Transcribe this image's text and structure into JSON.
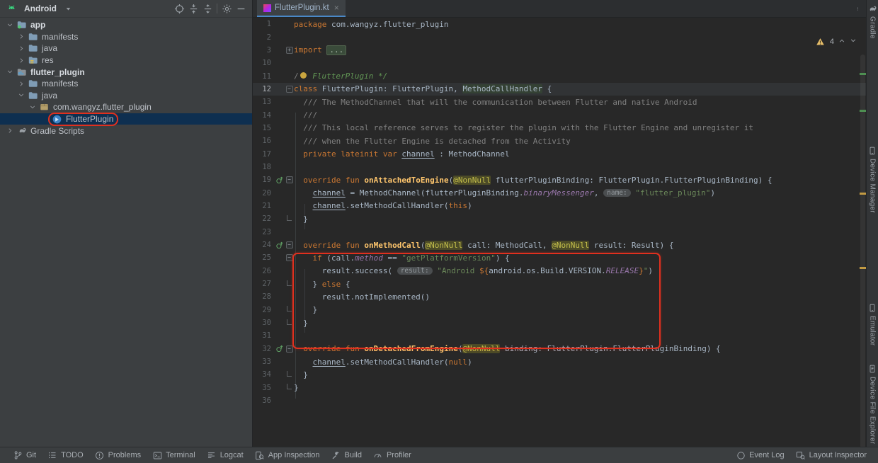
{
  "colors": {
    "annotation_red": "#e0301e",
    "accent_blue": "#4a88c7",
    "selection_bg": "#0e2f50",
    "warning_yellow": "#e8bf6a",
    "editor_bg": "#282828",
    "panel_bg": "#3c3f41"
  },
  "project_panel": {
    "header": {
      "title": "Android",
      "toolbar": [
        {
          "name": "locate"
        },
        {
          "name": "expand-all"
        },
        {
          "name": "collapse-all"
        },
        {
          "name": "sep"
        },
        {
          "name": "settings"
        },
        {
          "name": "hide-panel"
        }
      ]
    },
    "tree": [
      {
        "label": "app",
        "depth": 0,
        "arrow": "expanded",
        "icon": "folder-app",
        "bold": true
      },
      {
        "label": "manifests",
        "depth": 1,
        "arrow": "collapsed",
        "icon": "folder"
      },
      {
        "label": "java",
        "depth": 1,
        "arrow": "collapsed",
        "icon": "folder"
      },
      {
        "label": "res",
        "depth": 1,
        "arrow": "collapsed",
        "icon": "folder-res"
      },
      {
        "label": "flutter_plugin",
        "depth": 0,
        "arrow": "expanded",
        "icon": "module",
        "bold": true
      },
      {
        "label": "manifests",
        "depth": 1,
        "arrow": "collapsed",
        "icon": "folder"
      },
      {
        "label": "java",
        "depth": 1,
        "arrow": "expanded",
        "icon": "folder"
      },
      {
        "label": "com.wangyz.flutter_plugin",
        "depth": 2,
        "arrow": "expanded",
        "icon": "package"
      },
      {
        "label": "FlutterPlugin",
        "depth": 3,
        "arrow": "none",
        "icon": "kotlin-class",
        "selected": true,
        "annotated": true
      },
      {
        "label": "Gradle Scripts",
        "depth": 0,
        "arrow": "collapsed",
        "icon": "gradle"
      }
    ]
  },
  "editor": {
    "tab": {
      "title": "FlutterPlugin.kt",
      "close_label": "×"
    },
    "inspection_widget": {
      "warning_count": "4"
    },
    "lines": [
      {
        "n": "1",
        "g": [],
        "tok": [
          [
            "kw",
            "package"
          ],
          [
            "t",
            " com.wangyz.flutter_plugin"
          ]
        ]
      },
      {
        "n": "2",
        "g": [],
        "tok": []
      },
      {
        "n": "3",
        "g": [
          "plus"
        ],
        "tok": [
          [
            "kw",
            "import"
          ],
          [
            "t",
            " "
          ],
          [
            "fold",
            "..."
          ]
        ]
      },
      {
        "n": "10",
        "g": [],
        "tok": []
      },
      {
        "n": "11",
        "g": [],
        "tok": [
          [
            "cmt",
            "/"
          ],
          [
            "bulb",
            "*"
          ],
          [
            "cmtI",
            " FlutterPlugin */"
          ]
        ]
      },
      {
        "n": "12",
        "g": [
          "minus"
        ],
        "caret": true,
        "tok": [
          [
            "kw",
            "class"
          ],
          [
            "t",
            " FlutterPlugin: FlutterPlugin, "
          ],
          [
            "hl",
            "MethodCallHandler"
          ],
          [
            "t",
            " {"
          ]
        ]
      },
      {
        "n": "13",
        "g": [],
        "tok": [
          [
            "doc",
            "  /// The MethodChannel that will the communication between Flutter and native Android"
          ]
        ]
      },
      {
        "n": "14",
        "g": [],
        "tok": [
          [
            "doc",
            "  ///"
          ]
        ]
      },
      {
        "n": "15",
        "g": [],
        "tok": [
          [
            "doc",
            "  /// This local reference serves to register the plugin with the Flutter Engine and unregister it"
          ]
        ]
      },
      {
        "n": "16",
        "g": [],
        "tok": [
          [
            "doc",
            "  /// when the Flutter Engine is detached from the Activity"
          ]
        ]
      },
      {
        "n": "17",
        "g": [],
        "tok": [
          [
            "t",
            "  "
          ],
          [
            "kw",
            "private lateinit var"
          ],
          [
            "t",
            " "
          ],
          [
            "field",
            "channel"
          ],
          [
            "t",
            " : MethodChannel"
          ]
        ]
      },
      {
        "n": "18",
        "g": [],
        "tok": []
      },
      {
        "n": "19",
        "g": [
          "override",
          "minus"
        ],
        "tok": [
          [
            "t",
            "  "
          ],
          [
            "kw",
            "override fun"
          ],
          [
            "t",
            " "
          ],
          [
            "fn",
            "onAttachedToEngine"
          ],
          [
            "t",
            "("
          ],
          [
            "ann",
            "@NonNull"
          ],
          [
            "t",
            " flutterPluginBinding: FlutterPlugin.FlutterPluginBinding) {"
          ]
        ]
      },
      {
        "n": "20",
        "g": [],
        "tok": [
          [
            "t",
            "    "
          ],
          [
            "field",
            "channel"
          ],
          [
            "t",
            " = MethodChannel(flutterPluginBinding."
          ],
          [
            "prop",
            "binaryMessenger"
          ],
          [
            "t",
            ", "
          ],
          [
            "hint",
            "name:"
          ],
          [
            "t",
            " "
          ],
          [
            "str",
            "\"flutter_plugin\""
          ],
          [
            "t",
            ")"
          ]
        ]
      },
      {
        "n": "21",
        "g": [],
        "tok": [
          [
            "t",
            "    "
          ],
          [
            "field",
            "channel"
          ],
          [
            "t",
            ".setMethodCallHandler("
          ],
          [
            "kw",
            "this"
          ],
          [
            "t",
            ")"
          ]
        ]
      },
      {
        "n": "22",
        "g": [
          "end"
        ],
        "tok": [
          [
            "t",
            "  }"
          ]
        ]
      },
      {
        "n": "23",
        "g": [],
        "tok": []
      },
      {
        "n": "24",
        "g": [
          "override",
          "minus"
        ],
        "tok": [
          [
            "t",
            "  "
          ],
          [
            "kw",
            "override fun"
          ],
          [
            "t",
            " "
          ],
          [
            "fn",
            "onMethodCall"
          ],
          [
            "t",
            "("
          ],
          [
            "ann",
            "@NonNull"
          ],
          [
            "t",
            " call: MethodCall, "
          ],
          [
            "ann",
            "@NonNull"
          ],
          [
            "t",
            " result: Result) {"
          ]
        ]
      },
      {
        "n": "25",
        "g": [
          "minus"
        ],
        "tok": [
          [
            "t",
            "    "
          ],
          [
            "kw",
            "if"
          ],
          [
            "t",
            " (call."
          ],
          [
            "prop",
            "method"
          ],
          [
            "t",
            " == "
          ],
          [
            "str",
            "\"getPlatformVersion\""
          ],
          [
            "t",
            ") {"
          ]
        ]
      },
      {
        "n": "26",
        "g": [],
        "tok": [
          [
            "t",
            "      result.success( "
          ],
          [
            "hint",
            "result:"
          ],
          [
            "t",
            " "
          ],
          [
            "str",
            "\"Android "
          ],
          [
            "tpl",
            "${"
          ],
          [
            "t",
            "android.os.Build.VERSION."
          ],
          [
            "prop",
            "RELEASE"
          ],
          [
            "tpl",
            "}"
          ],
          [
            "str",
            "\""
          ],
          [
            "t",
            ")"
          ]
        ]
      },
      {
        "n": "27",
        "g": [
          "end"
        ],
        "tok": [
          [
            "t",
            "    } "
          ],
          [
            "kw",
            "else"
          ],
          [
            "t",
            " {"
          ]
        ]
      },
      {
        "n": "28",
        "g": [],
        "tok": [
          [
            "t",
            "      result.notImplemented()"
          ]
        ]
      },
      {
        "n": "29",
        "g": [
          "end"
        ],
        "tok": [
          [
            "t",
            "    }"
          ]
        ]
      },
      {
        "n": "30",
        "g": [
          "end"
        ],
        "tok": [
          [
            "t",
            "  }"
          ]
        ]
      },
      {
        "n": "31",
        "g": [],
        "tok": []
      },
      {
        "n": "32",
        "g": [
          "override",
          "minus"
        ],
        "tok": [
          [
            "t",
            "  "
          ],
          [
            "kw",
            "override fun"
          ],
          [
            "t",
            " "
          ],
          [
            "fn",
            "onDetachedFromEngine"
          ],
          [
            "t",
            "("
          ],
          [
            "ann",
            "@NonNull"
          ],
          [
            "t",
            " binding: FlutterPlugin.FlutterPluginBinding) {"
          ]
        ]
      },
      {
        "n": "33",
        "g": [],
        "tok": [
          [
            "t",
            "    "
          ],
          [
            "field",
            "channel"
          ],
          [
            "t",
            ".setMethodCallHandler("
          ],
          [
            "kw",
            "null"
          ],
          [
            "t",
            ")"
          ]
        ]
      },
      {
        "n": "34",
        "g": [
          "end"
        ],
        "tok": [
          [
            "t",
            "  }"
          ]
        ]
      },
      {
        "n": "35",
        "g": [
          "end"
        ],
        "tok": [
          [
            "t",
            "}"
          ]
        ]
      },
      {
        "n": "36",
        "g": [],
        "tok": []
      }
    ]
  },
  "right_stripe": {
    "items": [
      {
        "icon": "gradle",
        "label": "Gradle"
      },
      {
        "icon": "device",
        "label": "Device Manager"
      },
      {
        "icon": "device",
        "label": "Emulator"
      },
      {
        "icon": "device-explorer",
        "label": "Device File Explorer"
      }
    ]
  },
  "status_bar": {
    "left": [
      {
        "icon": "git-branch",
        "label": "Git"
      },
      {
        "icon": "todo",
        "label": "TODO"
      },
      {
        "icon": "problems",
        "label": "Problems"
      },
      {
        "icon": "terminal",
        "label": "Terminal"
      },
      {
        "icon": "logcat",
        "label": "Logcat"
      },
      {
        "icon": "app-inspection",
        "label": "App Inspection"
      },
      {
        "icon": "build",
        "label": "Build"
      },
      {
        "icon": "profiler",
        "label": "Profiler"
      }
    ],
    "right": [
      {
        "icon": "event-log",
        "label": "Event Log"
      },
      {
        "icon": "layout-inspector",
        "label": "Layout Inspector"
      }
    ]
  }
}
